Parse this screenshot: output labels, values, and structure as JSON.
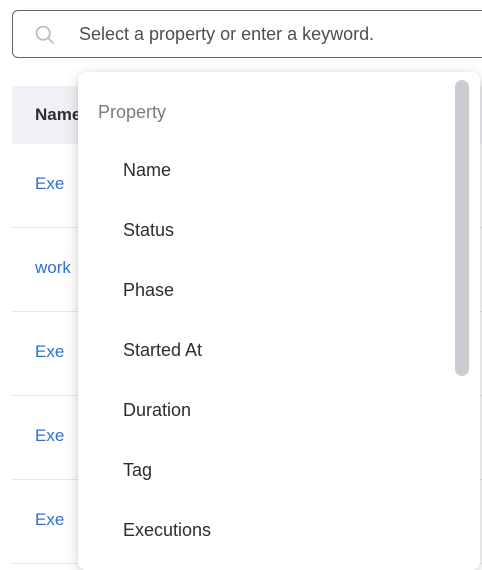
{
  "search": {
    "placeholder": "Select a property or enter a keyword."
  },
  "table": {
    "header": "Name",
    "rows": [
      {
        "name": "Exe"
      },
      {
        "name": "work"
      },
      {
        "name": "Exe"
      },
      {
        "name": "Exe"
      },
      {
        "name": "Exe"
      }
    ],
    "edge_chars": [
      ":",
      ":",
      ":",
      "/",
      ":",
      ":"
    ]
  },
  "dropdown": {
    "group_title": "Property",
    "items": [
      {
        "label": "Name"
      },
      {
        "label": "Status"
      },
      {
        "label": "Phase"
      },
      {
        "label": "Started At"
      },
      {
        "label": "Duration"
      },
      {
        "label": "Tag"
      },
      {
        "label": "Executions"
      }
    ]
  }
}
